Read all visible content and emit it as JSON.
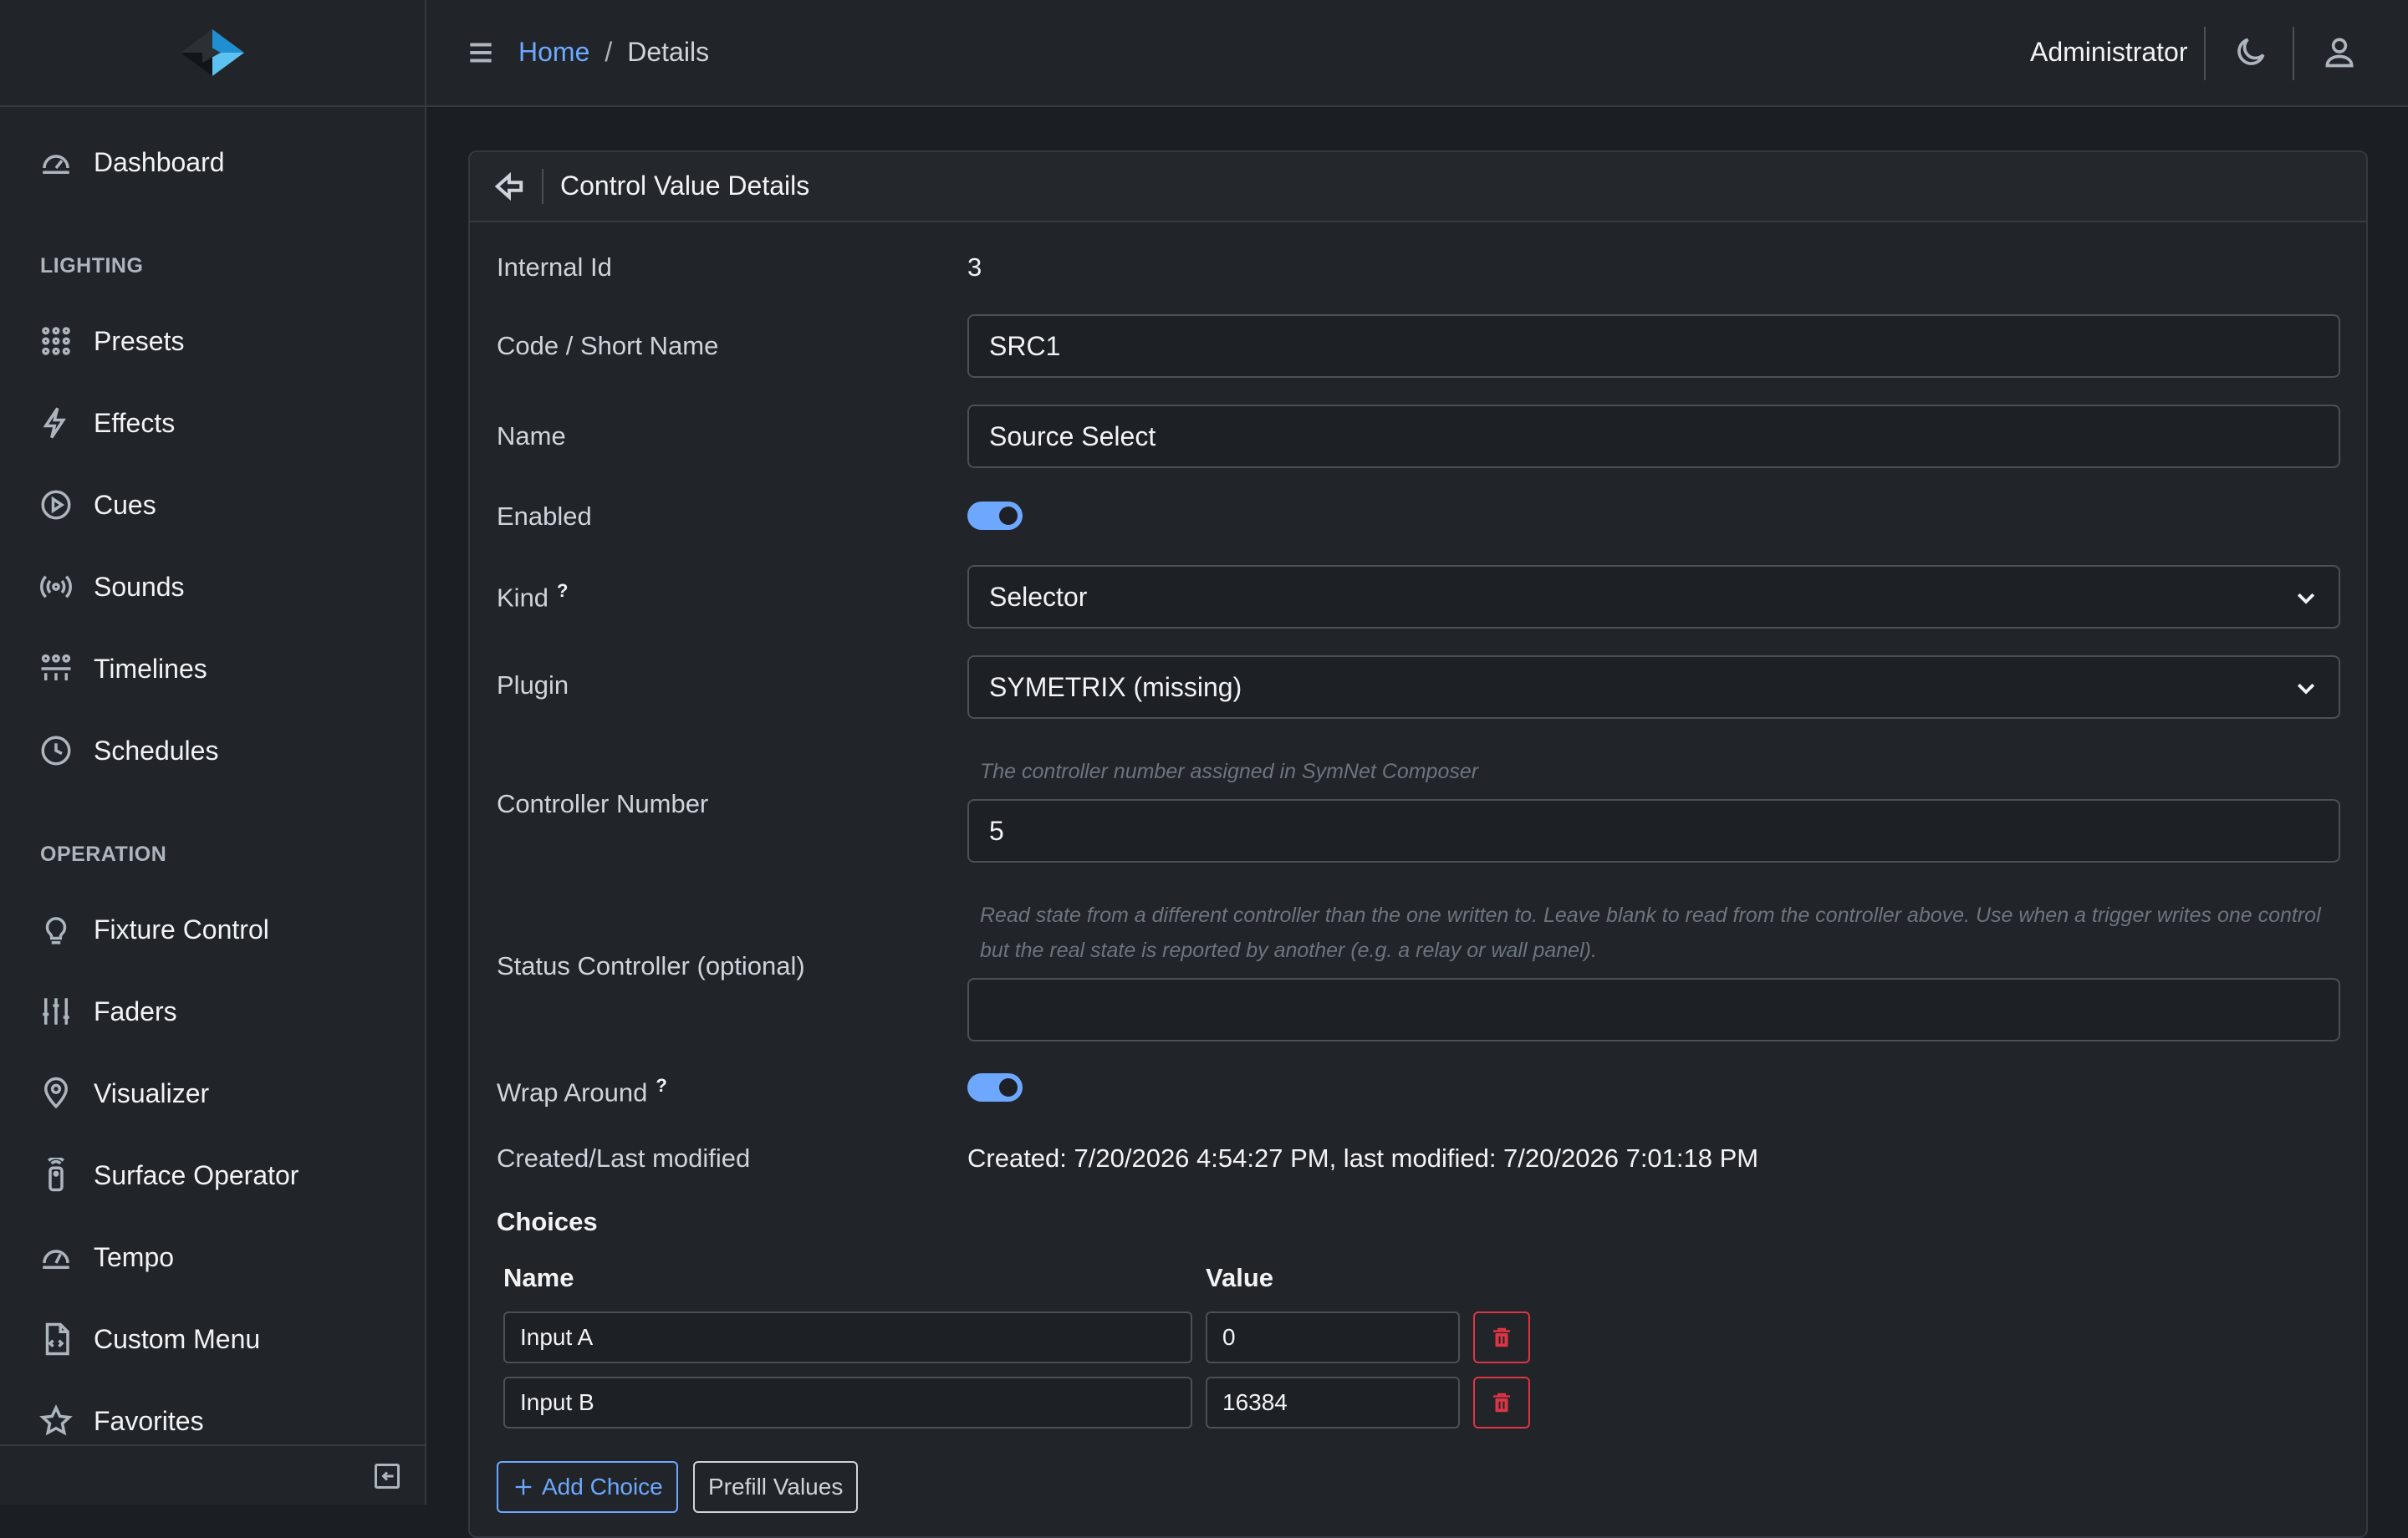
{
  "sidebar": {
    "dashboard": "Dashboard",
    "lighting_header": "LIGHTING",
    "lighting": [
      "Presets",
      "Effects",
      "Cues",
      "Sounds",
      "Timelines",
      "Schedules"
    ],
    "operation_header": "OPERATION",
    "operation": [
      "Fixture Control",
      "Faders",
      "Visualizer",
      "Surface Operator",
      "Tempo",
      "Custom Menu",
      "Favorites"
    ]
  },
  "header": {
    "breadcrumb_home": "Home",
    "breadcrumb_sep": "/",
    "breadcrumb_current": "Details",
    "user": "Administrator"
  },
  "card": {
    "title": "Control Value Details",
    "fields": {
      "internal_id_label": "Internal Id",
      "internal_id_value": "3",
      "code_label": "Code / Short Name",
      "code_value": "SRC1",
      "name_label": "Name",
      "name_value": "Source Select",
      "enabled_label": "Enabled",
      "enabled": true,
      "kind_label": "Kind",
      "kind_help": "?",
      "kind_value": "Selector",
      "plugin_label": "Plugin",
      "plugin_value": "SYMETRIX (missing)",
      "controller_label": "Controller Number",
      "controller_help": "The controller number assigned in SymNet Composer",
      "controller_value": "5",
      "status_label": "Status Controller (optional)",
      "status_help": "Read state from a different controller than the one written to. Leave blank to read from the controller above. Use when a trigger writes one control but the real state is reported by another (e.g. a relay or wall panel).",
      "status_value": "",
      "wrap_label": "Wrap Around",
      "wrap_help": "?",
      "wrap_enabled": true,
      "modified_label": "Created/Last modified",
      "modified_value": "Created: 7/20/2026 4:54:27 PM, last modified: 7/20/2026 7:01:18 PM"
    },
    "choices": {
      "title": "Choices",
      "col_name": "Name",
      "col_value": "Value",
      "rows": [
        {
          "name": "Input A",
          "value": "0"
        },
        {
          "name": "Input B",
          "value": "16384"
        }
      ],
      "add_label": "Add Choice",
      "prefill_label": "Prefill Values"
    }
  },
  "colors": {
    "accent": "#6ea8fe",
    "danger": "#dc3545",
    "background": "#1b1e23",
    "panel": "#212529"
  }
}
